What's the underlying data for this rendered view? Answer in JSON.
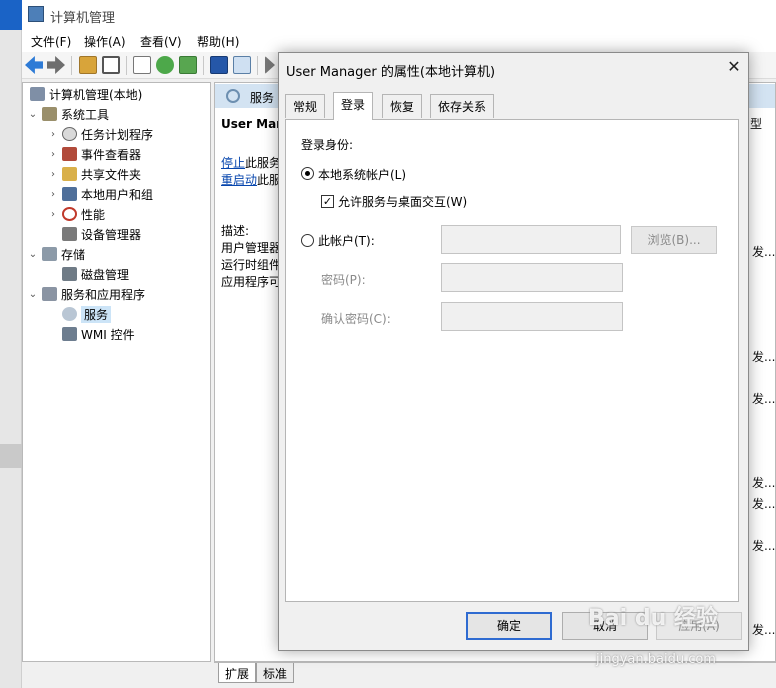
{
  "window": {
    "title": "计算机管理"
  },
  "menu": [
    "文件(F)",
    "操作(A)",
    "查看(V)",
    "帮助(H)"
  ],
  "tree": {
    "root": "计算机管理(本地)",
    "system_tools": "系统工具",
    "task_scheduler": "任务计划程序",
    "event_viewer": "事件查看器",
    "shared_folders": "共享文件夹",
    "local_users": "本地用户和组",
    "performance": "性能",
    "device_manager": "设备管理器",
    "storage": "存储",
    "disk_management": "磁盘管理",
    "services_apps": "服务和应用程序",
    "services": "服务",
    "wmi": "WMI 控件"
  },
  "middle": {
    "tab_label": "服务",
    "service_name": "User Man",
    "stop_link": "停止",
    "stop_rest": "此服务",
    "restart_link": "重启动",
    "restart_rest": "此服",
    "desc_label": "描述:",
    "desc_line1": "用户管理器",
    "desc_line2": "运行时组件",
    "desc_line3": "应用程序可",
    "right_type": "型",
    "right_fragments": [
      "发...",
      "发...",
      "发...",
      "发...",
      "发...",
      "发...",
      "发..."
    ]
  },
  "bottom_tabs": [
    "扩展",
    "标准"
  ],
  "dialog": {
    "title": "User Manager 的属性(本地计算机)",
    "close": "✕",
    "tabs": [
      "常规",
      "登录",
      "恢复",
      "依存关系"
    ],
    "active_tab": "登录",
    "logon_as": "登录身份:",
    "local_system": "本地系统帐户(L)",
    "allow_desktop": "允许服务与桌面交互(W)",
    "this_account": "此帐户(T):",
    "browse": "浏览(B)...",
    "password": "密码(P):",
    "confirm_password": "确认密码(C):",
    "ok": "确定",
    "cancel": "取消",
    "apply": "应用(A)"
  },
  "watermark": {
    "logo": "Bai du 经验",
    "sub": "jingyan.baidu.com"
  }
}
